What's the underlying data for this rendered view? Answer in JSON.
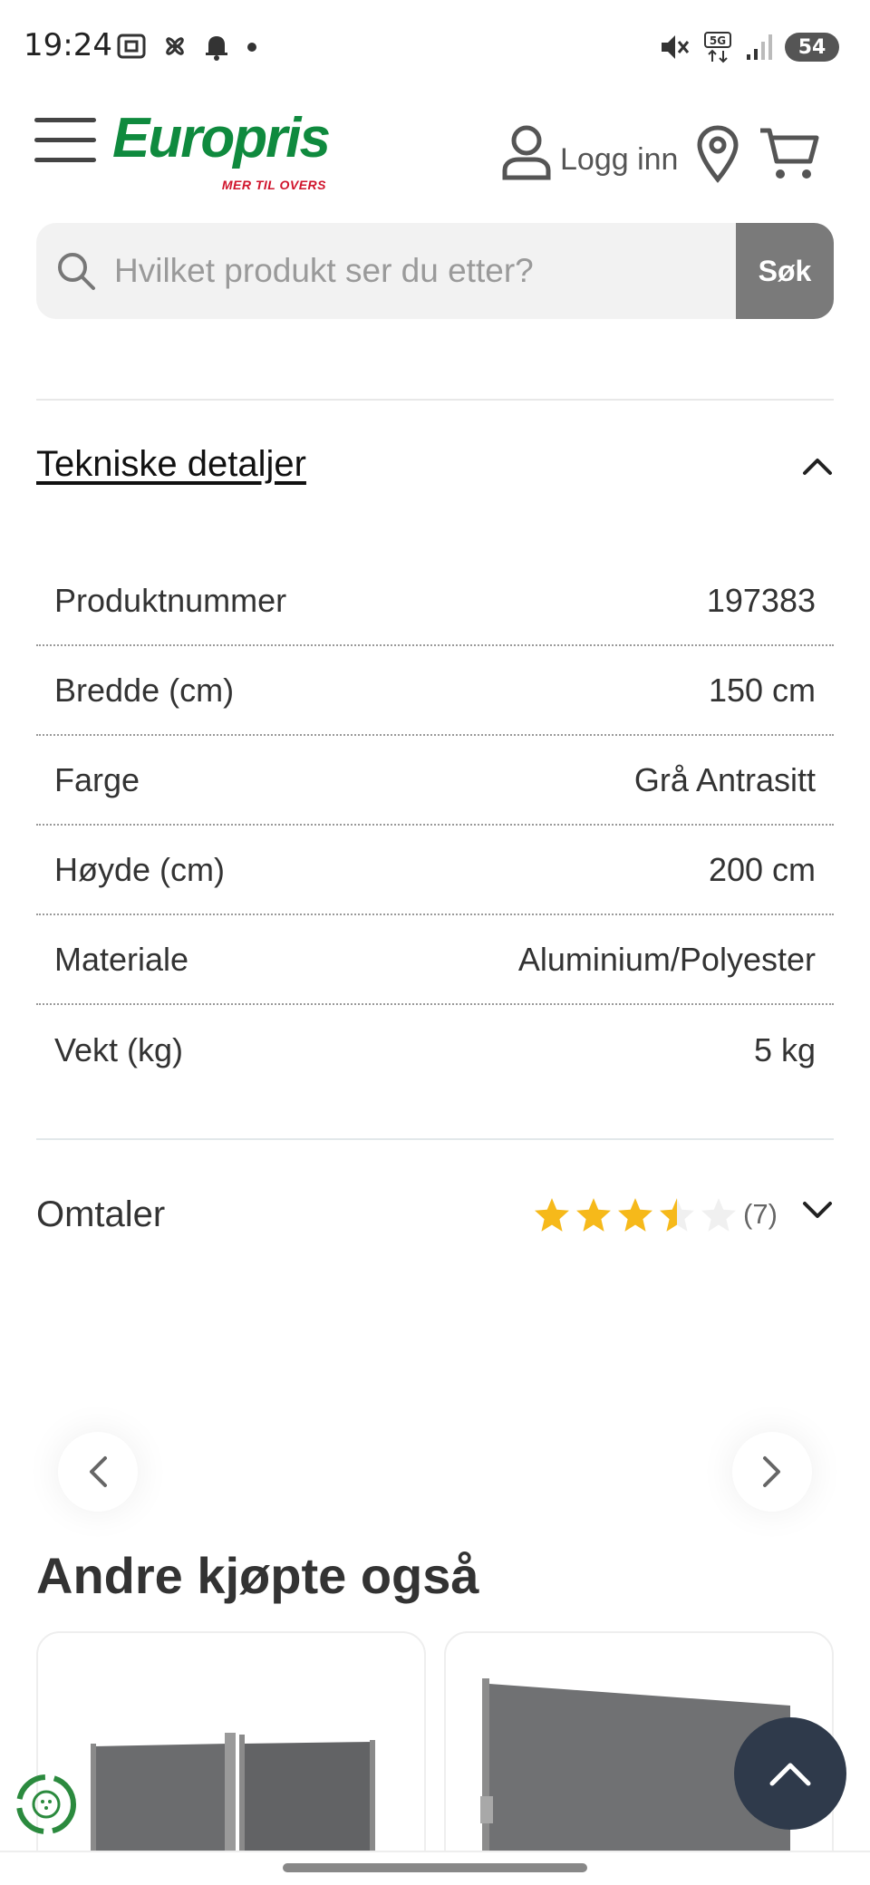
{
  "status_bar": {
    "time": "19:24",
    "network": "5G",
    "battery": "54"
  },
  "header": {
    "logo_text": "Europris",
    "logo_tagline": "MER TIL OVERS",
    "login_label": "Logg inn",
    "icons": [
      "menu-icon",
      "user-icon",
      "location-pin-icon",
      "cart-icon"
    ]
  },
  "search": {
    "placeholder": "Hvilket produkt ser du etter?",
    "button_label": "Søk"
  },
  "tech_details": {
    "title": "Tekniske detaljer",
    "expanded": true,
    "rows": [
      {
        "label": "Produktnummer",
        "value": "197383"
      },
      {
        "label": "Bredde (cm)",
        "value": "150 cm"
      },
      {
        "label": "Farge",
        "value": "Grå Antrasitt"
      },
      {
        "label": "Høyde (cm)",
        "value": "200 cm"
      },
      {
        "label": "Materiale",
        "value": "Aluminium/Polyester"
      },
      {
        "label": "Vekt (kg)",
        "value": "5 kg"
      }
    ]
  },
  "reviews": {
    "title": "Omtaler",
    "rating": 3.5,
    "max_rating": 5,
    "count_label": "(7)",
    "expanded": false
  },
  "also_bought": {
    "title": "Andre kjøpte også"
  },
  "colors": {
    "brand_green": "#0f8a3e",
    "brand_red": "#d0142c",
    "star_yellow": "#f6b91a",
    "search_button": "#7a7a7a",
    "scroll_top_button": "#2f3a4b"
  }
}
